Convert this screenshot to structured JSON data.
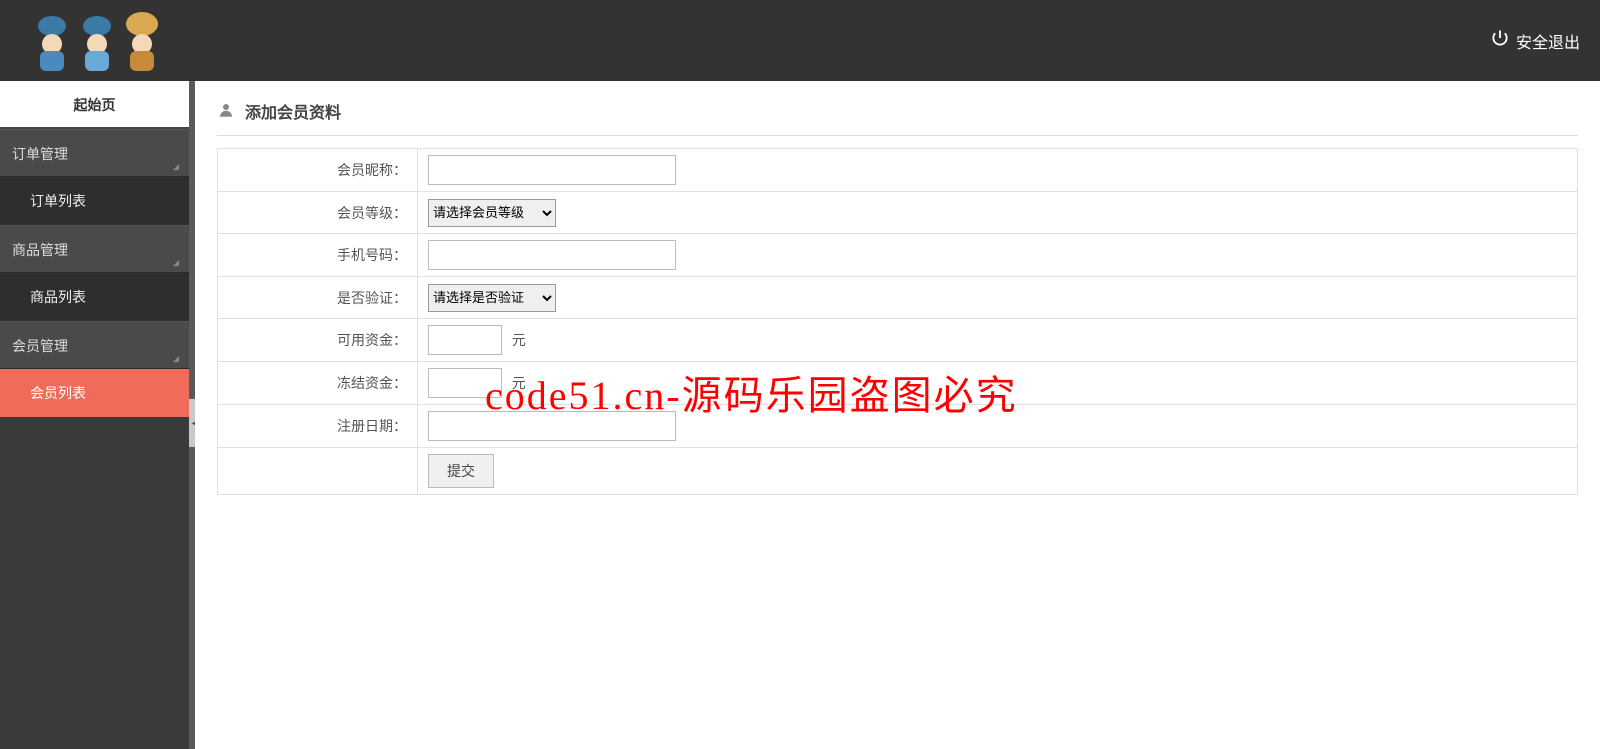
{
  "header": {
    "logout_label": "安全退出"
  },
  "sidebar": {
    "start_page": "起始页",
    "groups": [
      {
        "label": "订单管理",
        "items": [
          {
            "label": "订单列表",
            "active": false
          }
        ]
      },
      {
        "label": "商品管理",
        "items": [
          {
            "label": "商品列表",
            "active": false
          }
        ]
      },
      {
        "label": "会员管理",
        "items": [
          {
            "label": "会员列表",
            "active": true
          }
        ]
      }
    ]
  },
  "panel": {
    "title": "添加会员资料"
  },
  "form": {
    "nickname_label": "会员昵称：",
    "nickname_value": "",
    "level_label": "会员等级：",
    "level_selected": "请选择会员等级",
    "phone_label": "手机号码：",
    "phone_value": "",
    "verify_label": "是否验证：",
    "verify_selected": "请选择是否验证",
    "available_label": "可用资金：",
    "available_value": "",
    "available_unit": "元",
    "frozen_label": "冻结资金：",
    "frozen_value": "",
    "frozen_unit": "元",
    "regdate_label": "注册日期：",
    "regdate_value": "",
    "submit_label": "提交"
  },
  "watermark": "code51.cn-源码乐园盗图必究"
}
